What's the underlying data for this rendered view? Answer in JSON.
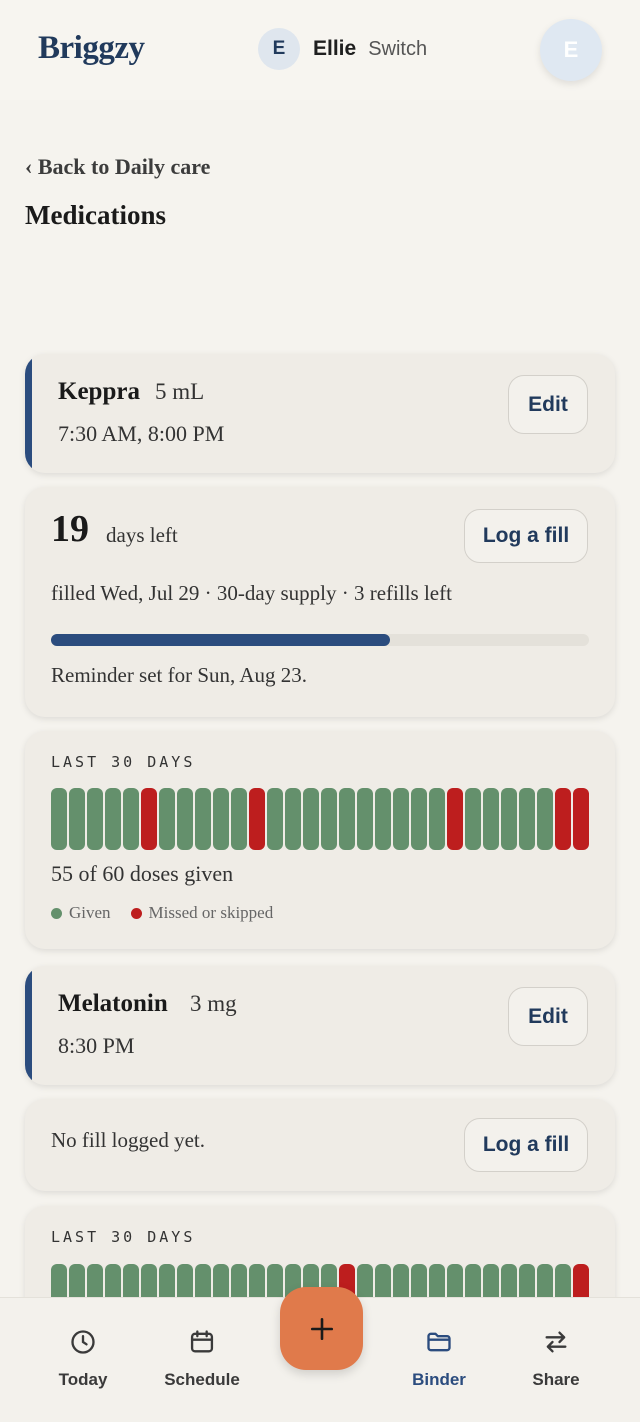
{
  "header": {
    "logo": "Briggzy",
    "profile_initial": "E",
    "profile_name": "Ellie",
    "switch_label": "Switch",
    "account_initial": "E"
  },
  "nav": {
    "back_label": "‹ Back to Daily care",
    "title": "Medications"
  },
  "medications": [
    {
      "name": "Keppra",
      "dose": "5 mL",
      "times": "7:30 AM, 8:00 PM",
      "edit_label": "Edit",
      "supply": {
        "days_left": "19",
        "days_left_label": "days left",
        "log_fill_label": "Log a fill",
        "fill_info": "filled Wed, Jul 29 · 30-day supply · 3 refills left",
        "progress": 0.63,
        "reminder": "Reminder set for Sun, Aug 23."
      },
      "history": {
        "label": "LAST 30 DAYS",
        "days": [
          "g",
          "g",
          "g",
          "g",
          "g",
          "m",
          "g",
          "g",
          "g",
          "g",
          "g",
          "m",
          "g",
          "g",
          "g",
          "g",
          "g",
          "g",
          "g",
          "g",
          "g",
          "g",
          "m",
          "g",
          "g",
          "g",
          "g",
          "g",
          "m",
          "m"
        ],
        "summary": "55 of 60 doses given",
        "legend_given": "Given",
        "legend_missed": "Missed or skipped"
      }
    },
    {
      "name": "Melatonin",
      "dose": "3 mg",
      "times": "8:30 PM",
      "edit_label": "Edit",
      "supply": {
        "no_fill": "No fill logged yet.",
        "log_fill_label": "Log a fill"
      },
      "history": {
        "label": "LAST 30 DAYS",
        "days": [
          "g",
          "g",
          "g",
          "g",
          "g",
          "g",
          "g",
          "g",
          "g",
          "g",
          "g",
          "g",
          "g",
          "g",
          "g",
          "g",
          "m",
          "g",
          "g",
          "g",
          "g",
          "g",
          "g",
          "g",
          "g",
          "g",
          "g",
          "g",
          "g",
          "m"
        ]
      }
    }
  ],
  "colors": {
    "given": "#64906c",
    "missed": "#bd1e1e",
    "accent": "#2b4c7e",
    "fab": "#e07a4b"
  },
  "bottom_nav": {
    "items": [
      {
        "label": "Today",
        "icon": "clock-icon"
      },
      {
        "label": "Schedule",
        "icon": "calendar-icon"
      },
      {
        "label": "Binder",
        "icon": "folder-icon",
        "active": true
      },
      {
        "label": "Share",
        "icon": "swap-arrows-icon"
      }
    ],
    "fab_icon": "plus-icon"
  }
}
